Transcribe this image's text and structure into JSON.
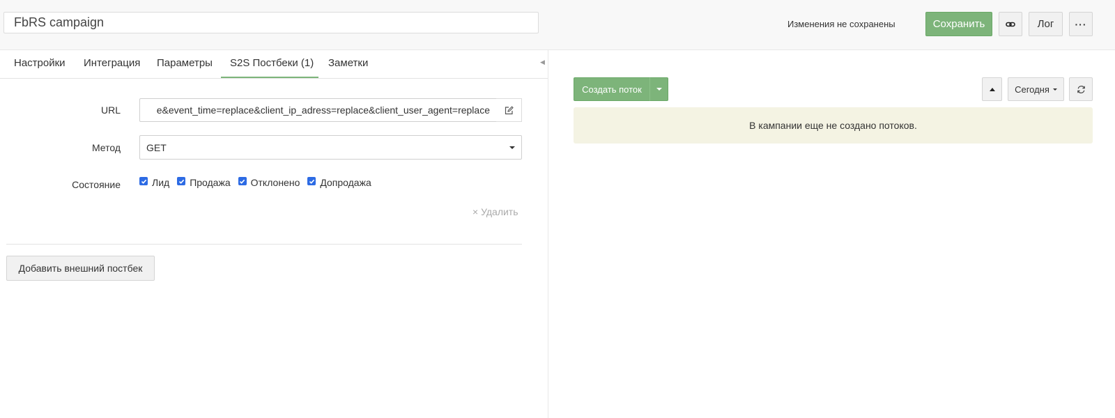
{
  "header": {
    "campaign_name": "FbRS campaign",
    "unsaved_text": "Изменения не сохранены",
    "save_label": "Сохранить",
    "log_label": "Лог",
    "more_label": "···"
  },
  "tabs": [
    {
      "label": "Настройки",
      "active": false
    },
    {
      "label": "Интеграция",
      "active": false
    },
    {
      "label": "Параметры",
      "active": false
    },
    {
      "label": "S2S Постбеки (1)",
      "active": true
    },
    {
      "label": "Заметки",
      "active": false
    }
  ],
  "postback": {
    "url_label": "URL",
    "url_value": "e&event_time=replace&client_ip_adress=replace&client_user_agent=replace",
    "method_label": "Метод",
    "method_value": "GET",
    "state_label": "Состояние",
    "states": [
      {
        "label": "Лид",
        "checked": true
      },
      {
        "label": "Продажа",
        "checked": true
      },
      {
        "label": "Отклонено",
        "checked": true
      },
      {
        "label": "Допродажа",
        "checked": true
      }
    ],
    "delete_label": "× Удалить"
  },
  "add_postback_label": "Добавить внешний постбек",
  "streams": {
    "create_label": "Создать поток",
    "date_filter": "Сегодня",
    "empty_message": "В кампании еще не создано потоков."
  },
  "colors": {
    "accent_green": "#7db47a",
    "checkbox_blue": "#2d6be4",
    "notice_bg": "#f4f3e3"
  }
}
